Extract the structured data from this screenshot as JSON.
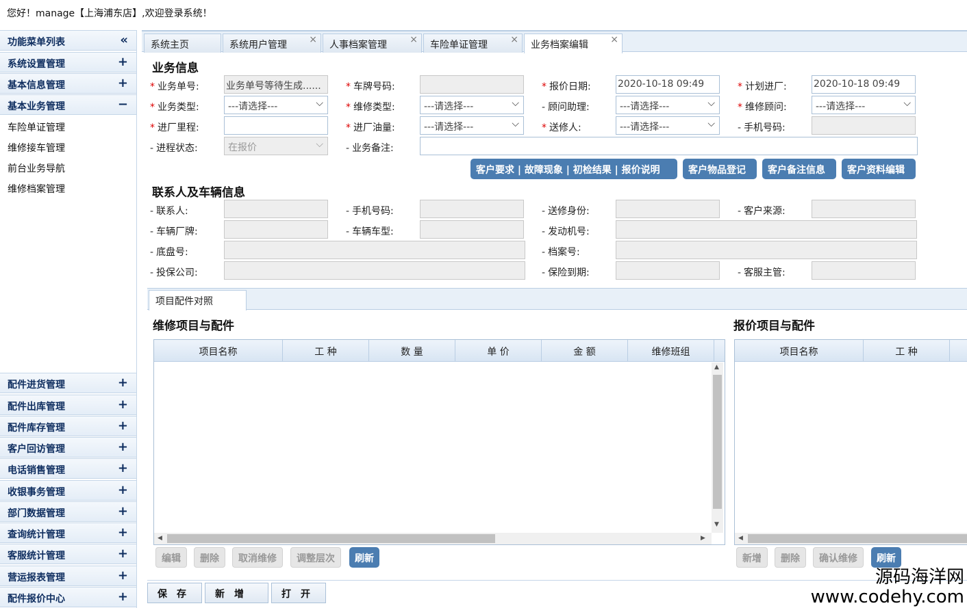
{
  "topbar": {
    "greeting": "您好！manage【上海浦东店】,欢迎登录系统！"
  },
  "sidebar": {
    "header": {
      "label": "功能菜单列表",
      "icon": "«"
    },
    "groups_top": [
      {
        "label": "系统设置管理",
        "icon": "+"
      },
      {
        "label": "基本信息管理",
        "icon": "+"
      },
      {
        "label": "基本业务管理",
        "icon": "−"
      }
    ],
    "sub_items": [
      "车险单证管理",
      "维修接车管理",
      "前台业务导航",
      "维修档案管理"
    ],
    "groups_bottom": [
      {
        "label": "配件进货管理",
        "icon": "+"
      },
      {
        "label": "配件出库管理",
        "icon": "+"
      },
      {
        "label": "配件库存管理",
        "icon": "+"
      },
      {
        "label": "客户回访管理",
        "icon": "+"
      },
      {
        "label": "电话销售管理",
        "icon": "+"
      },
      {
        "label": "收银事务管理",
        "icon": "+"
      },
      {
        "label": "部门数据管理",
        "icon": "+"
      },
      {
        "label": "查询统计管理",
        "icon": "+"
      },
      {
        "label": "客服统计管理",
        "icon": "+"
      },
      {
        "label": "营运报表管理",
        "icon": "+"
      },
      {
        "label": "配件报价中心",
        "icon": "+"
      }
    ]
  },
  "tabs": [
    {
      "label": "系统主页",
      "closable": false
    },
    {
      "label": "系统用户管理",
      "closable": true
    },
    {
      "label": "人事档案管理",
      "closable": true
    },
    {
      "label": "车险单证管理",
      "closable": true
    },
    {
      "label": "业务档案编辑",
      "closable": true,
      "active": true
    }
  ],
  "tab_close_glyph": "×",
  "business": {
    "title": "业务信息",
    "order_no": {
      "label": "业务单号:",
      "value": "业务单号等待生成......"
    },
    "plate_no": {
      "label": "车牌号码:",
      "value": ""
    },
    "quote_date": {
      "label": "报价日期:",
      "value": "2020-10-18 09:49"
    },
    "plan_in": {
      "label": "计划进厂:",
      "value": "2020-10-18 09:49"
    },
    "biz_type": {
      "label": "业务类型:",
      "value": "---请选择---"
    },
    "repair_type": {
      "label": "维修类型:",
      "value": "---请选择---"
    },
    "advisor_assist": {
      "label": "顾问助理:",
      "value": "---请选择---"
    },
    "repair_advisor": {
      "label": "维修顾问:",
      "value": "---请选择---"
    },
    "mileage": {
      "label": "进厂里程:",
      "value": ""
    },
    "fuel": {
      "label": "进厂油量:",
      "value": "---请选择---"
    },
    "sender": {
      "label": "送修人:",
      "value": "---请选择---"
    },
    "mobile": {
      "label": "手机号码:",
      "value": ""
    },
    "progress": {
      "label": "进程状态:",
      "value": "在报价"
    },
    "remark": {
      "label": "业务备注:",
      "value": ""
    },
    "buttons": [
      "客户要求 | 故障现象 | 初检结果 | 报价说明",
      "客户物品登记",
      "客户备注信息",
      "客户资料编辑"
    ]
  },
  "contact": {
    "title": "联系人及车辆信息",
    "contact_person": "联系人:",
    "mobile": "手机号码:",
    "sender_identity": "送修身份:",
    "source": "客户来源:",
    "brand": "车辆厂牌:",
    "model": "车辆车型:",
    "engine_no": "发动机号:",
    "chassis_no": "底盘号:",
    "archive_no": "档案号:",
    "insurer": "投保公司:",
    "insurance_expiry": "保险到期:",
    "service_manager": "客服主管:"
  },
  "sub_tab": "项目配件对照",
  "repair_grid": {
    "title": "维修项目与配件",
    "columns": [
      "项目名称",
      "工 种",
      "数 量",
      "单 价",
      "金 额",
      "维修班组"
    ],
    "buttons": [
      {
        "label": "编辑",
        "enabled": false
      },
      {
        "label": "删除",
        "enabled": false
      },
      {
        "label": "取消维修",
        "enabled": false
      },
      {
        "label": "调整层次",
        "enabled": false
      },
      {
        "label": "刷新",
        "enabled": true
      }
    ]
  },
  "quote_grid": {
    "title": "报价项目与配件",
    "columns": [
      "项目名称",
      "工 种"
    ],
    "buttons": [
      {
        "label": "新增",
        "enabled": false
      },
      {
        "label": "删除",
        "enabled": false
      },
      {
        "label": "确认维修",
        "enabled": false
      },
      {
        "label": "刷新",
        "enabled": true
      }
    ]
  },
  "bottom_buttons": [
    "保　存",
    "新　增",
    "打　开"
  ],
  "watermark": {
    "line1": "源码海洋网",
    "line2": "www.codehy.com"
  },
  "colors": {
    "accent": "#4b7db1",
    "required_star": "#dd0000",
    "header_text": "#0e2d5f"
  }
}
